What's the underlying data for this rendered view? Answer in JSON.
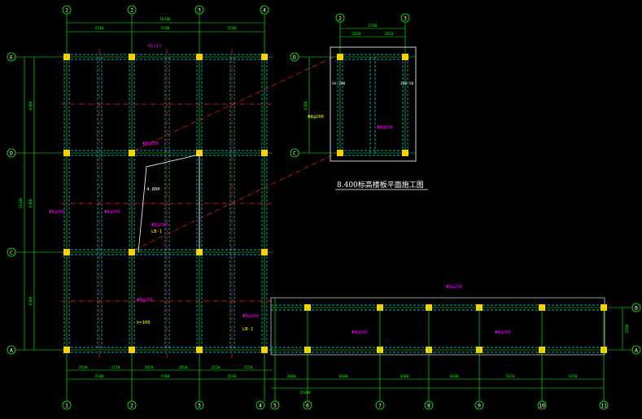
{
  "drawing": {
    "title": "8.400标高楼板平面施工图",
    "colors": {
      "background": "#000000",
      "grid_line": "#00ff00",
      "beam_cyan": "#00e5ff",
      "beam_red": "#ff2020",
      "column_yellow": "#ffd000",
      "annotation_magenta": "#ff00ff",
      "annotation_yellow": "#ffff00",
      "white": "#ffffff"
    }
  },
  "main_plan": {
    "col_axes": [
      "1",
      "2",
      "3",
      "4"
    ],
    "row_axes": [
      "E",
      "D",
      "C",
      "A"
    ],
    "top_total": "16780",
    "top_dims": [
      "5540",
      "5700",
      "5540"
    ],
    "bottom_dims_1": [
      "2150",
      "2750",
      "2850",
      "2850",
      "2150",
      "2750"
    ],
    "bottom_dims_2": [
      "5540",
      "5700",
      "5540"
    ],
    "left_total": "21100",
    "left_dims": [
      "6300",
      "6300",
      "6300"
    ],
    "span_label": "4.800"
  },
  "detail": {
    "col_axes": [
      "2",
      "3"
    ],
    "row_axes": [
      "D",
      "C"
    ],
    "top_total": "5700",
    "top_dims": [
      "2850",
      "2850"
    ],
    "left_dim": "6300",
    "side_marks": [
      "Sh.200",
      "200.50"
    ]
  },
  "lower_plan": {
    "col_axes": [
      "5",
      "6",
      "7",
      "8",
      "9",
      "10",
      "11"
    ],
    "row_axes": [
      "B",
      "A"
    ],
    "bottom_dims": [
      "3000",
      "6100",
      "4300",
      "4200",
      "5150",
      "5150"
    ],
    "bottom_total": "25400",
    "right_dim": "2100"
  },
  "annotations": {
    "beam_label": "KL(1)",
    "rebar_label": "Φ8@200",
    "slab_label": "LB-1",
    "h_label": "h=100"
  }
}
